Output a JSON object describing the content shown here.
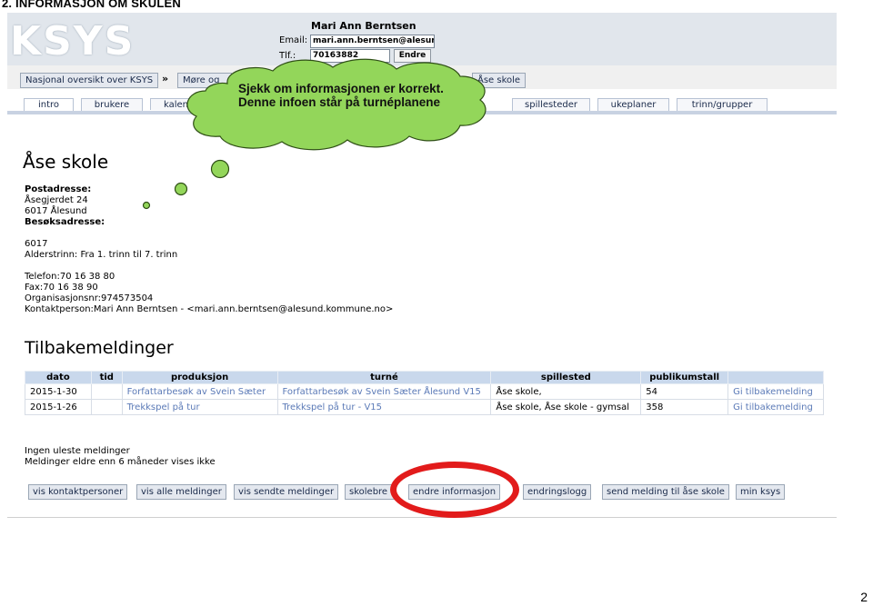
{
  "slide": {
    "title": "2. INFORMASJON OM SKULEN",
    "page_number": "2"
  },
  "header": {
    "logo": "KSYS",
    "user_name": "Mari Ann Berntsen",
    "email_label": "Email:",
    "email_value": "mari.ann.berntsen@alesund.",
    "tlf_label": "Tlf.:",
    "tlf_value": "70163882",
    "endre_label": "Endre"
  },
  "nav": {
    "overview": "Nasjonal oversikt over KSYS",
    "arrow": "»",
    "region": "Møre og",
    "school": "Åse skole"
  },
  "tabs": [
    "intro",
    "brukere",
    "kalen",
    "spillesteder",
    "ukeplaner",
    "trinn/grupper"
  ],
  "school": {
    "name": "Åse skole",
    "postadresse_label": "Postadresse:",
    "post_line1": "Åsegjerdet 24",
    "post_line2": "6017 Ålesund",
    "besok_label": "Besøksadresse:",
    "besok_line1": "6017",
    "alderstrinn": "Alderstrinn: Fra 1. trinn til 7. trinn",
    "telefon": "Telefon:70 16 38 80",
    "fax": "Fax:70 16 38 90",
    "orgnr": "Organisasjonsnr:974573504",
    "kontakt": "Kontaktperson:Mari Ann Berntsen - <mari.ann.berntsen@alesund.kommune.no>"
  },
  "feedback": {
    "title": "Tilbakemeldinger",
    "columns": [
      "dato",
      "tid",
      "produksjon",
      "turné",
      "spillested",
      "publikumstall",
      ""
    ],
    "rows": [
      [
        "2015-1-30",
        "",
        "Forfattarbesøk av Svein Sæter",
        "Forfattarbesøk av Svein Sæter Ålesund V15",
        "Åse skole,",
        "54",
        "Gi tilbakemelding"
      ],
      [
        "2015-1-26",
        "",
        "Trekkspel på tur",
        "Trekkspel på tur - V15",
        "Åse skole, Åse skole - gymsal",
        "358",
        "Gi tilbakemelding"
      ]
    ]
  },
  "messages": {
    "line1": "Ingen uleste meldinger",
    "line2": "Meldinger eldre enn 6 måneder vises ikke"
  },
  "actions": [
    "vis kontaktpersoner",
    "vis alle meldinger",
    "vis sendte meldinger",
    "skolebre",
    "endre informasjon",
    "endringslogg",
    "send melding til åse skole",
    "min ksys"
  ],
  "callout": {
    "text": "Sjekk om informasjonen er korrekt. Denne infoen står på turnéplanene",
    "cloud_color": "#93d65a",
    "highlight_color": "#e21b1b"
  }
}
